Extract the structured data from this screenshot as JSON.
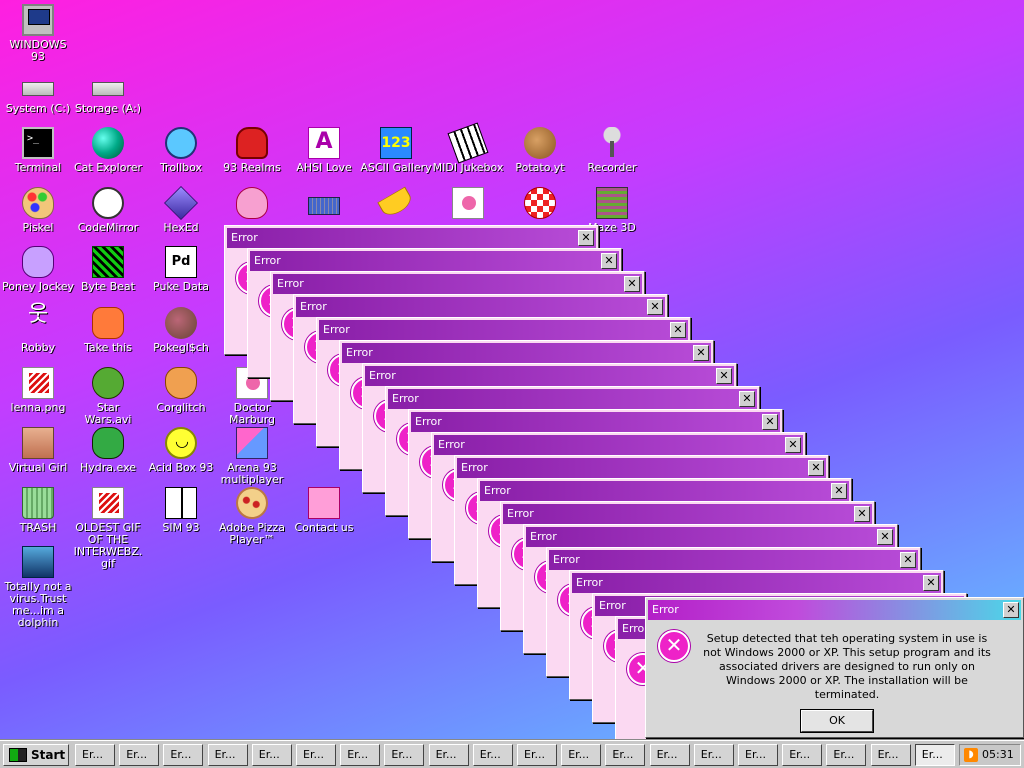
{
  "desktop": {
    "icons": [
      {
        "label": "WINDOWS 93"
      },
      {
        "label": "System (C:)"
      },
      {
        "label": "Storage (A:)"
      },
      {
        "label": "Terminal"
      },
      {
        "label": "Cat Explorer"
      },
      {
        "label": "Trollbox"
      },
      {
        "label": "93 Realms"
      },
      {
        "label": "AHSI Love"
      },
      {
        "label": "ASCII Gallery"
      },
      {
        "label": "MIDI Jukebox"
      },
      {
        "label": "Potato.yt"
      },
      {
        "label": "Recorder"
      },
      {
        "label": "Piskel"
      },
      {
        "label": "CodeMirror"
      },
      {
        "label": "HexEd"
      },
      {
        "label": "Poney Jockey"
      },
      {
        "label": "Byte Beat"
      },
      {
        "label": "Puke Data"
      },
      {
        "label": "Robby"
      },
      {
        "label": "Take this"
      },
      {
        "label": "Pokegl$ch"
      },
      {
        "label": "lenna.png"
      },
      {
        "label": "Star Wars.avi"
      },
      {
        "label": "Corglitch"
      },
      {
        "label": "Doctor Marburg"
      },
      {
        "label": "Virtual Girl"
      },
      {
        "label": "Hydra.exe"
      },
      {
        "label": "Acid Box 93"
      },
      {
        "label": "Arena 93 multiplayer"
      },
      {
        "label": "TRASH"
      },
      {
        "label": "OLDEST GIF OF THE INTERWEBZ.gif"
      },
      {
        "label": "SIM 93"
      },
      {
        "label": "Adobe Pizza Player™"
      },
      {
        "label": "Contact us"
      },
      {
        "label": "Totally not a virus.Trust me...im a dolphin"
      },
      {
        "label": "Maze 3D"
      }
    ]
  },
  "errors": {
    "title": "Error",
    "close_glyph": "✕",
    "icon_glyph": "✕",
    "message": "Setup detected that teh operating system in use is not Windows 2000 or XP. This setup program and its associated drivers are designed to run only on Windows 2000 or XP. The installation will be terminated.",
    "ok_label": "OK"
  },
  "taskbar": {
    "start_label": "Start",
    "task_label": "Er...",
    "clock": "05:31"
  },
  "colors": {
    "error_icon": "#ee22c8",
    "titlebar": "#8a1fa8"
  }
}
